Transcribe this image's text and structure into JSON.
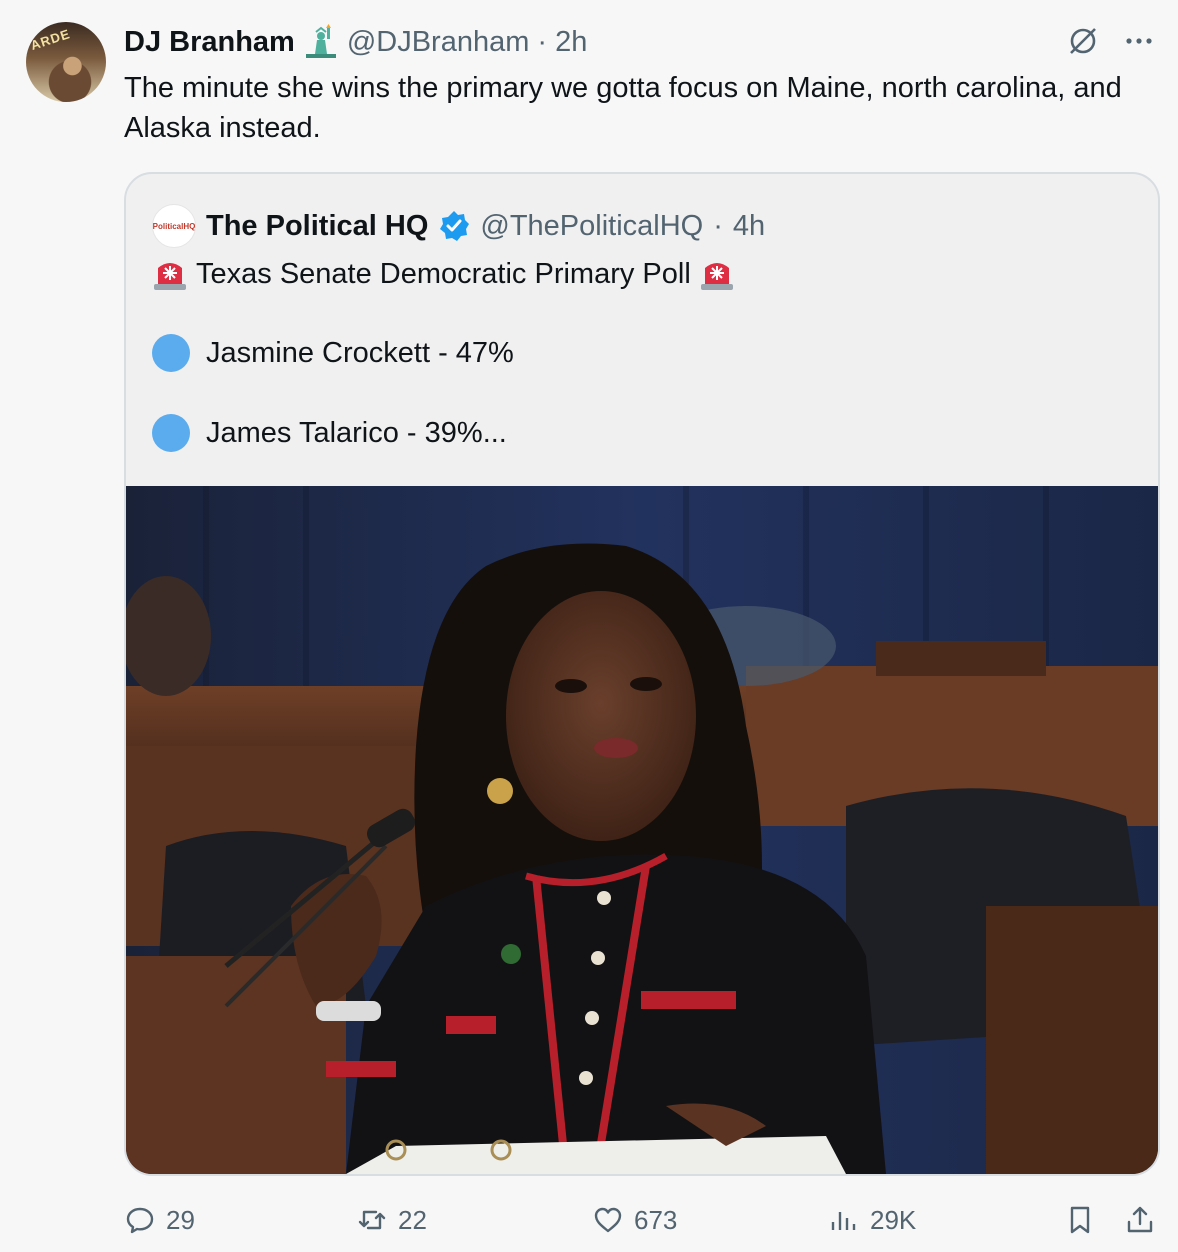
{
  "tweet": {
    "author_name": "DJ Branham",
    "author_handle": "@DJBranham",
    "separator": "·",
    "time": "2h",
    "text": "The minute she wins the primary we gotta focus on Maine, north carolina, and Alaska instead.",
    "avatar_sign_text": "ARDE"
  },
  "quote": {
    "author_name": "The Political HQ",
    "author_handle": "@ThePoliticalHQ",
    "separator": "·",
    "time": "4h",
    "avatar_text": "PoliticalHQ",
    "headline": "Texas Senate Democratic Primary Poll",
    "lines": [
      "Jasmine Crockett - 47%",
      "James Talarico - 39%..."
    ],
    "image_alt": "Woman speaking at a congressional hearing holding a pen"
  },
  "actions": {
    "replies": "29",
    "reposts": "22",
    "likes": "673",
    "views": "29K"
  },
  "colors": {
    "accent_blue": "#1d9bf0",
    "poll_dot": "#5aacee",
    "muted": "#536471"
  }
}
